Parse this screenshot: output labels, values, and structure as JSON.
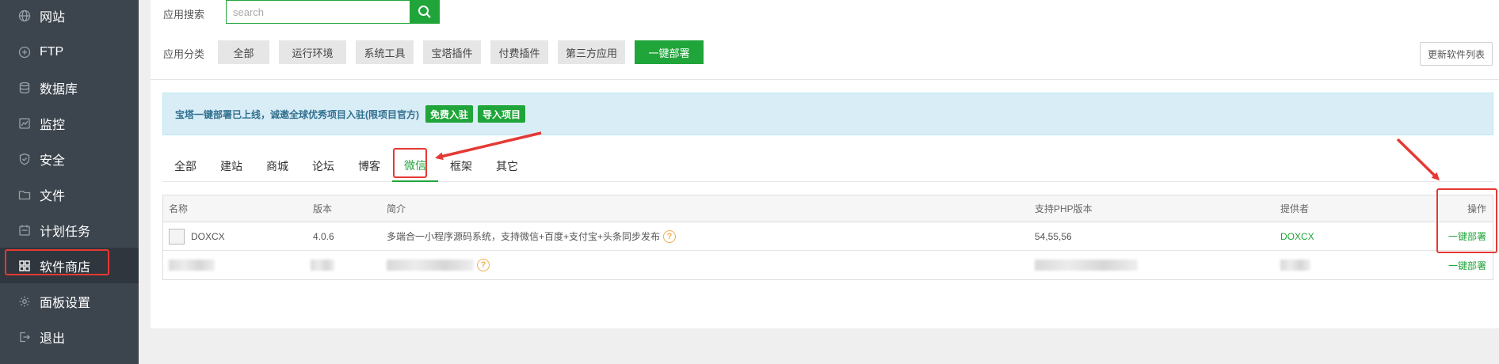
{
  "sidebar": {
    "items": [
      {
        "label": "网站",
        "icon": "globe-icon"
      },
      {
        "label": "FTP",
        "icon": "ftp-icon"
      },
      {
        "label": "数据库",
        "icon": "database-icon"
      },
      {
        "label": "监控",
        "icon": "monitor-icon"
      },
      {
        "label": "安全",
        "icon": "shield-icon"
      },
      {
        "label": "文件",
        "icon": "folder-icon"
      },
      {
        "label": "计划任务",
        "icon": "calendar-icon"
      },
      {
        "label": "软件商店",
        "icon": "apps-grid-icon",
        "active": true
      },
      {
        "label": "面板设置",
        "icon": "gear-icon"
      },
      {
        "label": "退出",
        "icon": "logout-icon"
      }
    ]
  },
  "search": {
    "label": "应用搜索",
    "placeholder": "search"
  },
  "categories": {
    "label": "应用分类",
    "items": [
      "全部",
      "运行环境",
      "系统工具",
      "宝塔插件",
      "付费插件",
      "第三方应用",
      "一键部署"
    ],
    "active": "一键部署"
  },
  "refresh_button": "更新软件列表",
  "notice": {
    "text": "宝塔一键部署已上线，诚邀全球优秀项目入驻(限项目官方)",
    "btn_join": "免费入驻",
    "btn_import": "导入项目"
  },
  "tabs": {
    "items": [
      "全部",
      "建站",
      "商城",
      "论坛",
      "博客",
      "微信",
      "框架",
      "其它"
    ],
    "active": "微信"
  },
  "table": {
    "headers": {
      "name": "名称",
      "version": "版本",
      "desc": "简介",
      "php": "支持PHP版本",
      "provider": "提供者",
      "action": "操作"
    },
    "rows": [
      {
        "name": "DOXCX",
        "version": "4.0.6",
        "desc": "多端合一小程序源码系统，支持微信+百度+支付宝+头条同步发布",
        "php": "54,55,56",
        "provider": "DOXCX",
        "action": "一键部署"
      },
      {
        "action": "一键部署"
      }
    ]
  },
  "colors": {
    "accent": "#20a53a",
    "sidebar_bg": "#3c444d",
    "annotation": "#e53935"
  }
}
